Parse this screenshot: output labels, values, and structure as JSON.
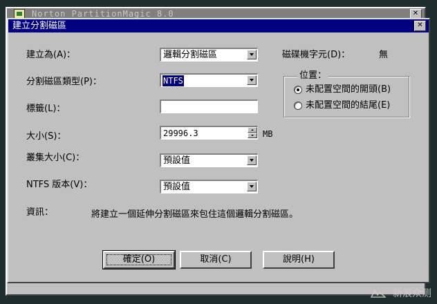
{
  "parent_window": {
    "title": "Norton PartitionMagic 8.0",
    "close_label": "✕"
  },
  "dialog": {
    "title": "建立分割磁區",
    "close_label": "✕"
  },
  "form": {
    "create_as_label": "建立為(A)：",
    "create_as_value": "邏輯分割磁區",
    "partition_type_label": "分割磁區類型(P)：",
    "partition_type_value": "NTFS",
    "volume_label_label": "標籤(L)：",
    "volume_label_value": "",
    "size_label": "大小(S)：",
    "size_value": "29996.3",
    "size_unit": "MB",
    "cluster_size_label": "叢集大小(C)：",
    "cluster_size_value": "預設值",
    "ntfs_version_label": "NTFS 版本(V)：",
    "ntfs_version_value": "預設值",
    "drive_letter_label": "磁碟機字元(D)：",
    "drive_letter_value": "無"
  },
  "position_group": {
    "title": "位置：",
    "options": [
      {
        "label": "未配置空間的開頭(B)",
        "checked": true
      },
      {
        "label": "未配置空間的結尾(E)",
        "checked": false
      }
    ]
  },
  "info": {
    "label": "資訊：",
    "text": "將建立一個延伸分割磁區來包住這個邏輯分割磁區。"
  },
  "buttons": {
    "ok": "確定(O)",
    "cancel": "取消(C)",
    "help": "說明(H)"
  },
  "watermark": "新浪众测"
}
